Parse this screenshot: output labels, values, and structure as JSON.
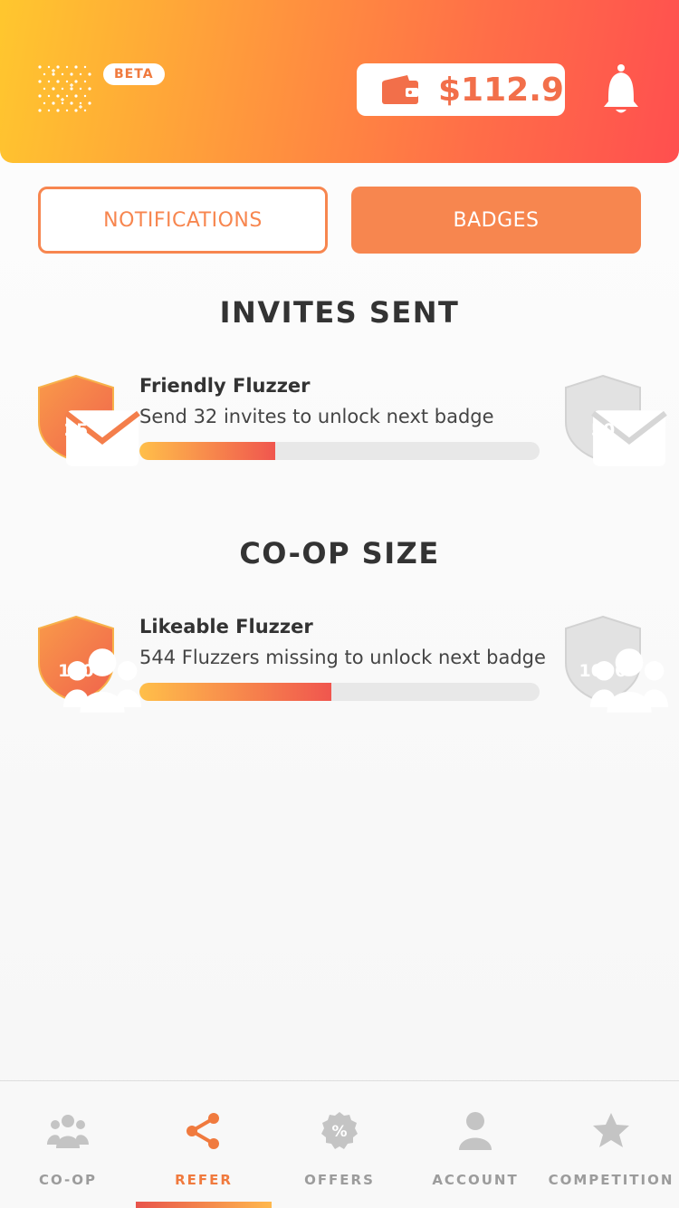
{
  "header": {
    "beta_label": "BETA",
    "balance": "$112.9",
    "icons": {
      "logo": "sparkle-logo",
      "wallet": "wallet-icon",
      "bell": "bell-icon"
    }
  },
  "tabs": [
    {
      "label": "NOTIFICATIONS",
      "active": false
    },
    {
      "label": "BADGES",
      "active": true
    }
  ],
  "sections": [
    {
      "title": "INVITES SENT",
      "badge_name": "Friendly Fluzzer",
      "description": "Send 32 invites to unlock next badge",
      "current_badge": "25",
      "next_badge": "50",
      "progress": 0.34,
      "icon": "envelope-icon"
    },
    {
      "title": "CO-OP SIZE",
      "badge_name": "Likeable Fluzzer",
      "description": "544 Fluzzers missing to unlock next badge",
      "current_badge": "100",
      "next_badge": "1000",
      "progress": 0.48,
      "icon": "group-icon"
    }
  ],
  "nav": [
    {
      "label": "CO-OP",
      "icon": "group-icon",
      "active": false
    },
    {
      "label": "REFER",
      "icon": "share-icon",
      "active": true
    },
    {
      "label": "OFFERS",
      "icon": "percent-badge-icon",
      "active": false
    },
    {
      "label": "ACCOUNT",
      "icon": "person-icon",
      "active": false
    },
    {
      "label": "COMPETITION",
      "icon": "star-icon",
      "active": false
    }
  ],
  "colors": {
    "accent": "#f7864f",
    "inactive_nav": "#9c9c9c",
    "badge_locked": "#dcdcdc",
    "header_gradient": [
      "#ffc72e",
      "#ff4f4f"
    ]
  }
}
